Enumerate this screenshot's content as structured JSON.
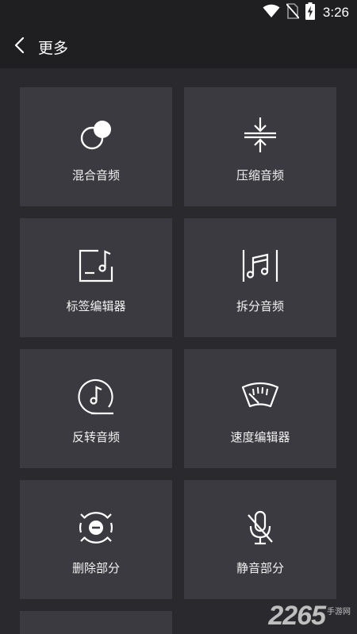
{
  "status_bar": {
    "time": "3:26",
    "icons": [
      "wifi-icon",
      "no-sim-icon",
      "battery-charging-icon"
    ]
  },
  "header": {
    "back_icon": "chevron-left-icon",
    "title": "更多"
  },
  "tiles": [
    {
      "label": "混合音频",
      "icon": "mix-circles-icon"
    },
    {
      "label": "压缩音频",
      "icon": "compress-arrows-icon"
    },
    {
      "label": "标签编辑器",
      "icon": "tag-music-icon"
    },
    {
      "label": "拆分音频",
      "icon": "split-music-icon"
    },
    {
      "label": "反转音频",
      "icon": "reverse-music-icon"
    },
    {
      "label": "速度编辑器",
      "icon": "speed-gauge-icon"
    },
    {
      "label": "删除部分",
      "icon": "delete-part-icon"
    },
    {
      "label": "静音部分",
      "icon": "mute-mic-icon"
    }
  ],
  "watermark": {
    "number": "2265",
    "text": "手游网"
  },
  "colors": {
    "background": "#2a2a2e",
    "bar": "#1f1f22",
    "tile": "#3a3a40",
    "text": "#ffffff"
  }
}
